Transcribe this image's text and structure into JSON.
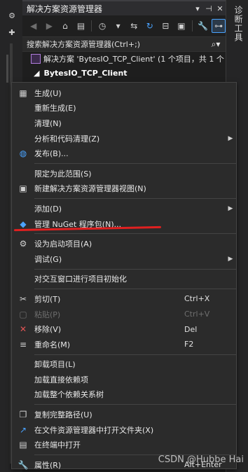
{
  "left_strip": {
    "icons": [
      "gear-icon",
      "pin-icon"
    ]
  },
  "right_strip": {
    "vertical_tab": "诊断工具"
  },
  "panel": {
    "title": "解决方案资源管理器",
    "title_icons": [
      "dropdown-icon",
      "pin-icon",
      "close-icon"
    ],
    "search_placeholder": "搜索解决方案资源管理器(Ctrl+;)",
    "solution_label": "解决方案 'BytesIO_TCP_Client' (1 个项目，共 1 个",
    "project_label": "BytesIO_TCP_Client"
  },
  "menu": {
    "items": [
      {
        "id": "build",
        "label": "生成(U)",
        "icon": "build-icon",
        "shortcut": "",
        "arrow": false,
        "disabled": false
      },
      {
        "id": "rebuild",
        "label": "重新生成(E)",
        "icon": "",
        "shortcut": "",
        "arrow": false,
        "disabled": false
      },
      {
        "id": "clean",
        "label": "清理(N)",
        "icon": "",
        "shortcut": "",
        "arrow": false,
        "disabled": false
      },
      {
        "id": "analyze",
        "label": "分析和代码清理(Z)",
        "icon": "",
        "shortcut": "",
        "arrow": true,
        "disabled": false
      },
      {
        "id": "publish",
        "label": "发布(B)...",
        "icon": "globe-icon",
        "shortcut": "",
        "arrow": false,
        "disabled": false
      },
      {
        "sep": true
      },
      {
        "id": "scope",
        "label": "限定为此范围(S)",
        "icon": "",
        "shortcut": "",
        "arrow": false,
        "disabled": false
      },
      {
        "id": "newview",
        "label": "新建解决方案资源管理器视图(N)",
        "icon": "new-view-icon",
        "shortcut": "",
        "arrow": false,
        "disabled": false
      },
      {
        "sep": true
      },
      {
        "id": "add",
        "label": "添加(D)",
        "icon": "",
        "shortcut": "",
        "arrow": true,
        "disabled": false
      },
      {
        "id": "nuget",
        "label": "管理 NuGet 程序包(N)...",
        "icon": "nuget-icon",
        "shortcut": "",
        "arrow": false,
        "disabled": false
      },
      {
        "sep": true
      },
      {
        "id": "startup",
        "label": "设为启动项目(A)",
        "icon": "gear-icon",
        "shortcut": "",
        "arrow": false,
        "disabled": false
      },
      {
        "id": "debug",
        "label": "调试(G)",
        "icon": "",
        "shortcut": "",
        "arrow": true,
        "disabled": false
      },
      {
        "sep": true
      },
      {
        "id": "interactive",
        "label": "对交互窗口进行项目初始化",
        "icon": "",
        "shortcut": "",
        "arrow": false,
        "disabled": false
      },
      {
        "sep": true
      },
      {
        "id": "cut",
        "label": "剪切(T)",
        "icon": "scissors-icon",
        "shortcut": "Ctrl+X",
        "arrow": false,
        "disabled": false
      },
      {
        "id": "paste",
        "label": "粘贴(P)",
        "icon": "paste-icon",
        "shortcut": "Ctrl+V",
        "arrow": false,
        "disabled": true
      },
      {
        "id": "remove",
        "label": "移除(V)",
        "icon": "remove-icon",
        "shortcut": "Del",
        "arrow": false,
        "disabled": false
      },
      {
        "id": "rename",
        "label": "重命名(M)",
        "icon": "rename-icon",
        "shortcut": "F2",
        "arrow": false,
        "disabled": false
      },
      {
        "sep": true
      },
      {
        "id": "unload",
        "label": "卸载项目(L)",
        "icon": "",
        "shortcut": "",
        "arrow": false,
        "disabled": false
      },
      {
        "id": "loaddirect",
        "label": "加载直接依赖项",
        "icon": "",
        "shortcut": "",
        "arrow": false,
        "disabled": false
      },
      {
        "id": "loadtree",
        "label": "加载整个依赖关系树",
        "icon": "",
        "shortcut": "",
        "arrow": false,
        "disabled": false
      },
      {
        "sep": true
      },
      {
        "id": "copypath",
        "label": "复制完整路径(U)",
        "icon": "copy-icon",
        "shortcut": "",
        "arrow": false,
        "disabled": false
      },
      {
        "id": "openfolder",
        "label": "在文件资源管理器中打开文件夹(X)",
        "icon": "open-folder-icon",
        "shortcut": "",
        "arrow": false,
        "disabled": false
      },
      {
        "id": "terminal",
        "label": "在终端中打开",
        "icon": "terminal-icon",
        "shortcut": "",
        "arrow": false,
        "disabled": false
      },
      {
        "sep": true
      },
      {
        "id": "properties",
        "label": "属性(R)",
        "icon": "wrench-icon",
        "shortcut": "Alt+Enter",
        "arrow": false,
        "disabled": false
      }
    ]
  },
  "watermark": "CSDN @Hubbe Hai",
  "colors": {
    "annotation_red": "#e02020",
    "accent_blue": "#4aa3ff"
  }
}
